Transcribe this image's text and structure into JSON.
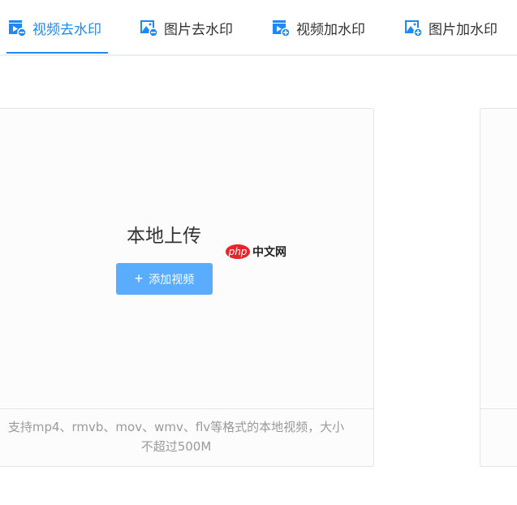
{
  "tabs": [
    {
      "label": "视频去水印",
      "icon": "video-remove-icon",
      "active": true
    },
    {
      "label": "图片去水印",
      "icon": "image-remove-icon",
      "active": false
    },
    {
      "label": "视频加水印",
      "icon": "video-add-icon",
      "active": false
    },
    {
      "label": "图片加水印",
      "icon": "image-add-icon",
      "active": false
    }
  ],
  "upload_card": {
    "title": "本地上传",
    "button_label": "添加视频",
    "button_icon": "plus-icon",
    "hint": "支持mp4、rmvb、mov、wmv、flv等格式的本地视频，大小不超过500M"
  },
  "watermark": {
    "php": "php",
    "cn": "中文网"
  },
  "colors": {
    "accent": "#1e88f5",
    "button": "#5aacff"
  }
}
